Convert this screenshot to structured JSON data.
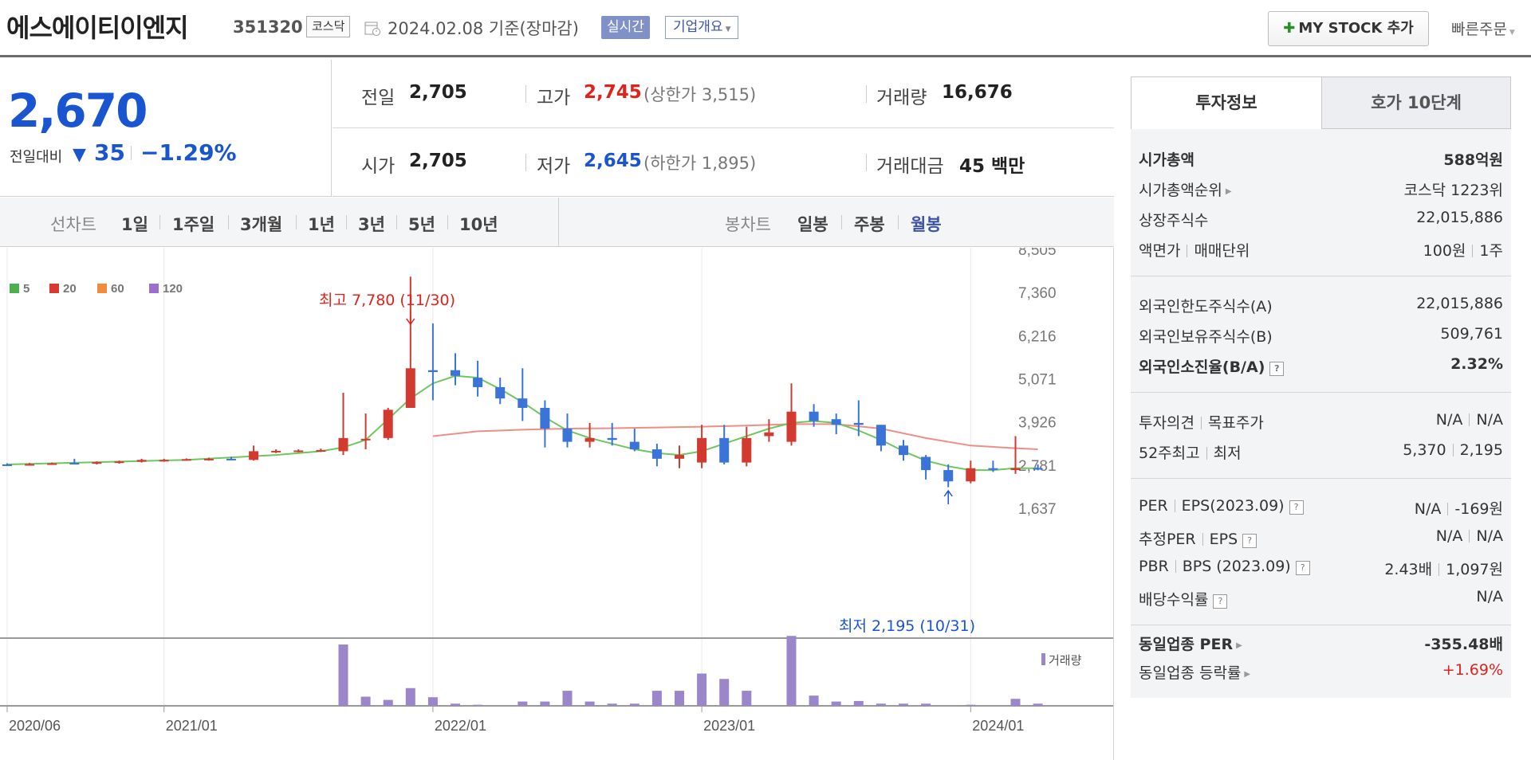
{
  "header": {
    "company_name": "에스에이티이엔지",
    "stock_code": "351320",
    "market": "코스닥",
    "date_label": "2024.02.08 기준(장마감)",
    "realtime_button": "실시간",
    "overview_dropdown": "기업개요",
    "mystock_button": "MY STOCK 추가",
    "quick_order": "빠른주문"
  },
  "price": {
    "current": "2,670",
    "change_label": "전일대비",
    "change_value": "35",
    "change_pct": "−1.29%",
    "direction": "down"
  },
  "stats": {
    "prev_close_label": "전일",
    "prev_close": "2,705",
    "high_label": "고가",
    "high": "2,745",
    "upper_limit": "(상한가 3,515)",
    "volume_label": "거래량",
    "volume": "16,676",
    "open_label": "시가",
    "open": "2,705",
    "low_label": "저가",
    "low": "2,645",
    "lower_limit": "(하한가 1,895)",
    "amount_label": "거래대금",
    "amount": "45 백만"
  },
  "chart_tabs": {
    "line_label": "선차트",
    "line_items": [
      "1일",
      "1주일",
      "3개월",
      "1년",
      "3년",
      "5년",
      "10년"
    ],
    "candle_label": "봉차트",
    "candle_items": [
      "일봉",
      "주봉",
      "월봉"
    ],
    "active_candle": "월봉"
  },
  "colors": {
    "up": "#d23a30",
    "down": "#3a74d8",
    "ma5": "#6ec75e",
    "ma120": "#ee8e86"
  },
  "chart_data": {
    "type": "candlestick",
    "title": "",
    "legend": [
      {
        "name": "5",
        "color": "#4caf50"
      },
      {
        "name": "20",
        "color": "#d93a2f"
      },
      {
        "name": "60",
        "color": "#f08c3c"
      },
      {
        "name": "120",
        "color": "#9a6fd0"
      }
    ],
    "y_ticks": [
      "8,505",
      "7,360",
      "6,216",
      "5,071",
      "3,926",
      "2,781",
      "1,637"
    ],
    "ylim": [
      1637,
      8505
    ],
    "x_ticks": [
      "2020/06",
      "2021/01",
      "2022/01",
      "2023/01",
      "2024/01"
    ],
    "annotation_high": "최고 7,780 (11/30)",
    "annotation_low": "최저 2,195 (10/31)",
    "volume_label": "거래량",
    "candles": [
      {
        "m": "2020-06",
        "o": 2800,
        "h": 2830,
        "l": 2770,
        "c": 2790,
        "v": 0
      },
      {
        "m": "2020-07",
        "o": 2800,
        "h": 2840,
        "l": 2780,
        "c": 2810,
        "v": 0
      },
      {
        "m": "2020-08",
        "o": 2810,
        "h": 2850,
        "l": 2790,
        "c": 2830,
        "v": 0
      },
      {
        "m": "2020-09",
        "o": 2840,
        "h": 2950,
        "l": 2800,
        "c": 2820,
        "v": 0
      },
      {
        "m": "2020-10",
        "o": 2830,
        "h": 2880,
        "l": 2800,
        "c": 2860,
        "v": 0
      },
      {
        "m": "2020-11",
        "o": 2850,
        "h": 2900,
        "l": 2820,
        "c": 2880,
        "v": 0
      },
      {
        "m": "2020-12",
        "o": 2870,
        "h": 2950,
        "l": 2850,
        "c": 2920,
        "v": 0
      },
      {
        "m": "2021-01",
        "o": 2900,
        "h": 2950,
        "l": 2870,
        "c": 2920,
        "v": 0
      },
      {
        "m": "2021-02",
        "o": 2920,
        "h": 2960,
        "l": 2900,
        "c": 2940,
        "v": 0
      },
      {
        "m": "2021-03",
        "o": 2940,
        "h": 2980,
        "l": 2900,
        "c": 2950,
        "v": 0
      },
      {
        "m": "2021-04",
        "o": 2950,
        "h": 3000,
        "l": 2910,
        "c": 2930,
        "v": 0
      },
      {
        "m": "2021-05",
        "o": 2920,
        "h": 3300,
        "l": 2900,
        "c": 3150,
        "v": 0
      },
      {
        "m": "2021-06",
        "o": 3150,
        "h": 3200,
        "l": 3100,
        "c": 3160,
        "v": 0
      },
      {
        "m": "2021-07",
        "o": 3160,
        "h": 3200,
        "l": 3120,
        "c": 3170,
        "v": 0
      },
      {
        "m": "2021-08",
        "o": 3170,
        "h": 3220,
        "l": 3130,
        "c": 3180,
        "v": 0
      },
      {
        "m": "2021-09",
        "o": 3150,
        "h": 4700,
        "l": 3050,
        "c": 3500,
        "v": 570
      },
      {
        "m": "2021-10",
        "o": 3450,
        "h": 4150,
        "l": 3200,
        "c": 3480,
        "v": 85
      },
      {
        "m": "2021-11",
        "o": 3500,
        "h": 4300,
        "l": 3450,
        "c": 4250,
        "v": 55
      },
      {
        "m": "2021-12",
        "o": 4300,
        "h": 7780,
        "l": 4300,
        "c": 5350,
        "v": 165
      },
      {
        "m": "2022-01",
        "o": 5300,
        "h": 6540,
        "l": 4500,
        "c": 5250,
        "v": 80
      },
      {
        "m": "2022-02",
        "o": 5300,
        "h": 5750,
        "l": 4900,
        "c": 5150,
        "v": 20
      },
      {
        "m": "2022-03",
        "o": 5100,
        "h": 5550,
        "l": 4600,
        "c": 4850,
        "v": 10
      },
      {
        "m": "2022-04",
        "o": 4850,
        "h": 5100,
        "l": 4400,
        "c": 4550,
        "v": 0
      },
      {
        "m": "2022-05",
        "o": 4550,
        "h": 5350,
        "l": 3950,
        "c": 4300,
        "v": 40
      },
      {
        "m": "2022-06",
        "o": 4300,
        "h": 4500,
        "l": 3250,
        "c": 3750,
        "v": 40
      },
      {
        "m": "2022-07",
        "o": 3750,
        "h": 4150,
        "l": 3250,
        "c": 3400,
        "v": 140
      },
      {
        "m": "2022-08",
        "o": 3400,
        "h": 3900,
        "l": 3250,
        "c": 3500,
        "v": 40
      },
      {
        "m": "2022-09",
        "o": 3500,
        "h": 3900,
        "l": 3300,
        "c": 3450,
        "v": 20
      },
      {
        "m": "2022-10",
        "o": 3400,
        "h": 3750,
        "l": 3150,
        "c": 3200,
        "v": 20
      },
      {
        "m": "2022-11",
        "o": 3200,
        "h": 3350,
        "l": 2750,
        "c": 2950,
        "v": 140
      },
      {
        "m": "2022-12",
        "o": 2950,
        "h": 3300,
        "l": 2700,
        "c": 3050,
        "v": 140
      },
      {
        "m": "2023-01",
        "o": 2850,
        "h": 3850,
        "l": 2700,
        "c": 3500,
        "v": 300
      },
      {
        "m": "2023-02",
        "o": 3500,
        "h": 3850,
        "l": 2800,
        "c": 2850,
        "v": 250
      },
      {
        "m": "2023-03",
        "o": 2850,
        "h": 3800,
        "l": 2750,
        "c": 3500,
        "v": 140
      },
      {
        "m": "2023-04",
        "o": 3550,
        "h": 4000,
        "l": 3400,
        "c": 3650,
        "v": 0
      },
      {
        "m": "2023-05",
        "o": 3400,
        "h": 4950,
        "l": 3300,
        "c": 4200,
        "v": 650
      },
      {
        "m": "2023-06",
        "o": 4200,
        "h": 4400,
        "l": 3800,
        "c": 3950,
        "v": 95
      },
      {
        "m": "2023-07",
        "o": 4000,
        "h": 4150,
        "l": 3600,
        "c": 3850,
        "v": 40
      },
      {
        "m": "2023-08",
        "o": 3900,
        "h": 4500,
        "l": 3550,
        "c": 3850,
        "v": 45
      },
      {
        "m": "2023-09",
        "o": 3850,
        "h": 3850,
        "l": 3150,
        "c": 3300,
        "v": 20
      },
      {
        "m": "2023-10",
        "o": 3300,
        "h": 3450,
        "l": 2900,
        "c": 3050,
        "v": 20
      },
      {
        "m": "2023-11",
        "o": 3000,
        "h": 3050,
        "l": 2400,
        "c": 2650,
        "v": 20
      },
      {
        "m": "2023-12",
        "o": 2650,
        "h": 2800,
        "l": 2195,
        "c": 2350,
        "v": 0
      },
      {
        "m": "2024-01",
        "o": 2350,
        "h": 2900,
        "l": 2300,
        "c": 2700,
        "v": 10
      },
      {
        "m": "2024-02",
        "o": 2700,
        "h": 2900,
        "l": 2600,
        "c": 2680,
        "v": 0
      },
      {
        "m": "2024-03",
        "o": 2650,
        "h": 3550,
        "l": 2550,
        "c": 2700,
        "v": 65
      },
      {
        "m": "2024-04",
        "o": 2705,
        "h": 2800,
        "l": 2645,
        "c": 2670,
        "v": 20
      }
    ],
    "ma_short": [
      [
        0,
        2800
      ],
      [
        8,
        2920
      ],
      [
        12,
        3050
      ],
      [
        14,
        3150
      ],
      [
        15,
        3250
      ],
      [
        16,
        3450
      ],
      [
        17,
        4000
      ],
      [
        18,
        4550
      ],
      [
        19,
        4950
      ],
      [
        20,
        5150
      ],
      [
        21,
        5100
      ],
      [
        22,
        4800
      ],
      [
        23,
        4450
      ],
      [
        24,
        4050
      ],
      [
        25,
        3700
      ],
      [
        26,
        3500
      ],
      [
        27,
        3350
      ],
      [
        28,
        3200
      ],
      [
        29,
        3100
      ],
      [
        30,
        3050
      ],
      [
        31,
        3150
      ],
      [
        32,
        3350
      ],
      [
        33,
        3550
      ],
      [
        34,
        3750
      ],
      [
        35,
        3900
      ],
      [
        36,
        3950
      ],
      [
        37,
        3900
      ],
      [
        38,
        3700
      ],
      [
        39,
        3450
      ],
      [
        40,
        3150
      ],
      [
        41,
        2900
      ],
      [
        42,
        2750
      ],
      [
        43,
        2650
      ],
      [
        44,
        2650
      ],
      [
        45,
        2700
      ],
      [
        46,
        2700
      ]
    ],
    "ma_long": [
      [
        19,
        3550
      ],
      [
        21,
        3680
      ],
      [
        23,
        3720
      ],
      [
        25,
        3750
      ],
      [
        27,
        3760
      ],
      [
        29,
        3780
      ],
      [
        31,
        3800
      ],
      [
        33,
        3830
      ],
      [
        35,
        3870
      ],
      [
        37,
        3870
      ],
      [
        39,
        3750
      ],
      [
        41,
        3500
      ],
      [
        43,
        3300
      ],
      [
        45,
        3230
      ],
      [
        46,
        3200
      ]
    ]
  },
  "info_panel": {
    "tab_invest": "투자정보",
    "tab_orderbook": "호가 10단계",
    "market_cap_label": "시가총액",
    "market_cap": "588억원",
    "market_cap_rank_label": "시가총액순위",
    "market_cap_rank": "코스닥 1223위",
    "shares_label": "상장주식수",
    "shares": "22,015,886",
    "face_value_label": "액면가",
    "trading_unit_label": "매매단위",
    "face_value": "100원",
    "trading_unit": "1주",
    "foreign_limit_label": "외국인한도주식수(A)",
    "foreign_limit": "22,015,886",
    "foreign_hold_label": "외국인보유주식수(B)",
    "foreign_hold": "509,761",
    "foreign_ratio_label": "외국인소진율(B/A)",
    "foreign_ratio": "2.32%",
    "opinion_label": "투자의견",
    "target_label": "목표주가",
    "opinion": "N/A",
    "target": "N/A",
    "wk52_high_label": "52주최고",
    "wk52_low_label": "최저",
    "wk52_high": "5,370",
    "wk52_low": "2,195",
    "per_label": "PER",
    "eps_label": "EPS(2023.09)",
    "per": "N/A",
    "eps": "-169원",
    "est_per_label": "추정PER",
    "est_eps_label": "EPS",
    "est_per": "N/A",
    "est_eps": "N/A",
    "pbr_label": "PBR",
    "bps_label": "BPS (2023.09)",
    "pbr": "2.43배",
    "bps": "1,097원",
    "dividend_label": "배당수익률",
    "dividend": "N/A",
    "industry_per_label": "동일업종 PER",
    "industry_per": "-355.48배",
    "industry_chg_label": "동일업종 등락률",
    "industry_chg": "+1.69%",
    "help_mark": "?"
  }
}
